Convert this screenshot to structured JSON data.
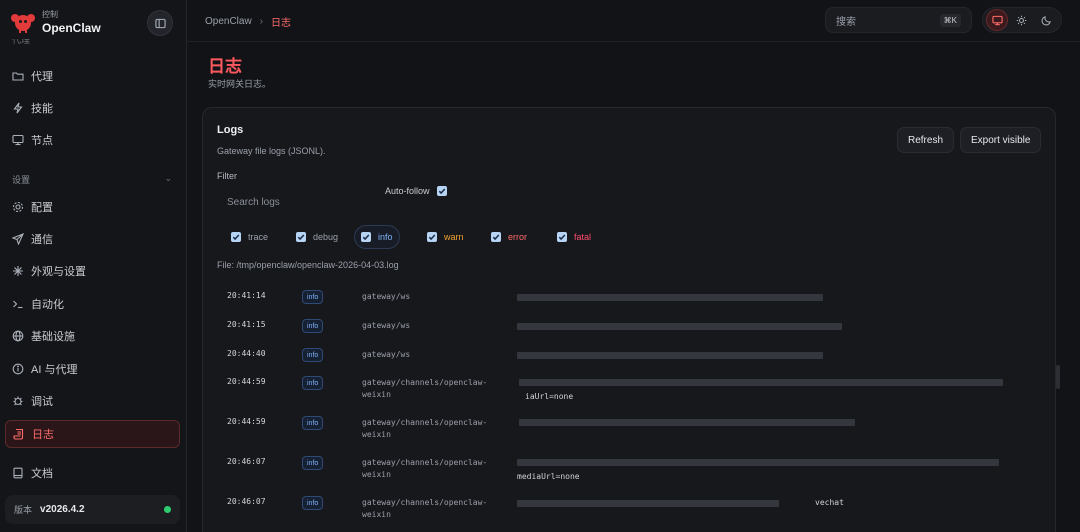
{
  "brand": {
    "sub": "控制",
    "name": "OpenClaw"
  },
  "sidebar": {
    "clipped_label": "代理",
    "items_top": [
      {
        "label": "代理",
        "icon": "folder-icon"
      },
      {
        "label": "技能",
        "icon": "zap-icon"
      },
      {
        "label": "节点",
        "icon": "monitor-icon"
      }
    ],
    "section": "设置",
    "items_settings": [
      {
        "label": "配置",
        "icon": "gear-icon"
      },
      {
        "label": "通信",
        "icon": "send-icon"
      },
      {
        "label": "外观与设置",
        "icon": "sparkle-icon"
      },
      {
        "label": "自动化",
        "icon": "terminal-icon"
      },
      {
        "label": "基础设施",
        "icon": "globe-icon"
      },
      {
        "label": "AI 与代理",
        "icon": "info-icon"
      },
      {
        "label": "调试",
        "icon": "bug-icon"
      },
      {
        "label": "日志",
        "icon": "scroll-icon",
        "active": true
      }
    ],
    "docs": {
      "label": "文档",
      "icon": "book-icon"
    },
    "version": {
      "label": "版本",
      "value": "v2026.4.2"
    }
  },
  "topbar": {
    "breadcrumb_root": "OpenClaw",
    "breadcrumb_sep": "›",
    "breadcrumb_current": "日志",
    "search_placeholder": "搜索",
    "search_kbd": "⌘K"
  },
  "page": {
    "title": "日志",
    "subtitle": "实时网关日志。"
  },
  "card": {
    "title": "Logs",
    "subtitle": "Gateway file logs (JSONL).",
    "refresh": "Refresh",
    "export": "Export visible",
    "filter_label": "Filter",
    "search_placeholder": "Search logs",
    "autofollow": "Auto-follow",
    "levels": [
      {
        "label": "trace",
        "color": "#9aa0aa"
      },
      {
        "label": "debug",
        "color": "#9aa0aa"
      },
      {
        "label": "info",
        "color": "#7fb1f7",
        "active": true
      },
      {
        "label": "warn",
        "color": "#f0a030"
      },
      {
        "label": "error",
        "color": "#ff6b6b"
      },
      {
        "label": "fatal",
        "color": "#ff4d6d"
      }
    ],
    "file": "File: /tmp/openclaw/openclaw-2026-04-03.log"
  },
  "logs": [
    {
      "time": "20:41:14",
      "level": "info",
      "source": "gateway/ws",
      "message": ""
    },
    {
      "time": "20:41:15",
      "level": "info",
      "source": "gateway/ws",
      "message": ""
    },
    {
      "time": "20:44:40",
      "level": "info",
      "source": "gateway/ws",
      "message": ""
    },
    {
      "time": "20:44:59",
      "level": "info",
      "source": "gateway/channels/openclaw-\nweixin",
      "message": "iaUrl=none"
    },
    {
      "time": "20:44:59",
      "level": "info",
      "source": "gateway/channels/openclaw-\nweixin",
      "message": ""
    },
    {
      "time": "20:46:07",
      "level": "info",
      "source": "gateway/channels/openclaw-\nweixin",
      "message": "mediaUrl=none"
    },
    {
      "time": "20:46:07",
      "level": "info",
      "source": "gateway/channels/openclaw-\nweixin",
      "message": "vechat"
    }
  ]
}
